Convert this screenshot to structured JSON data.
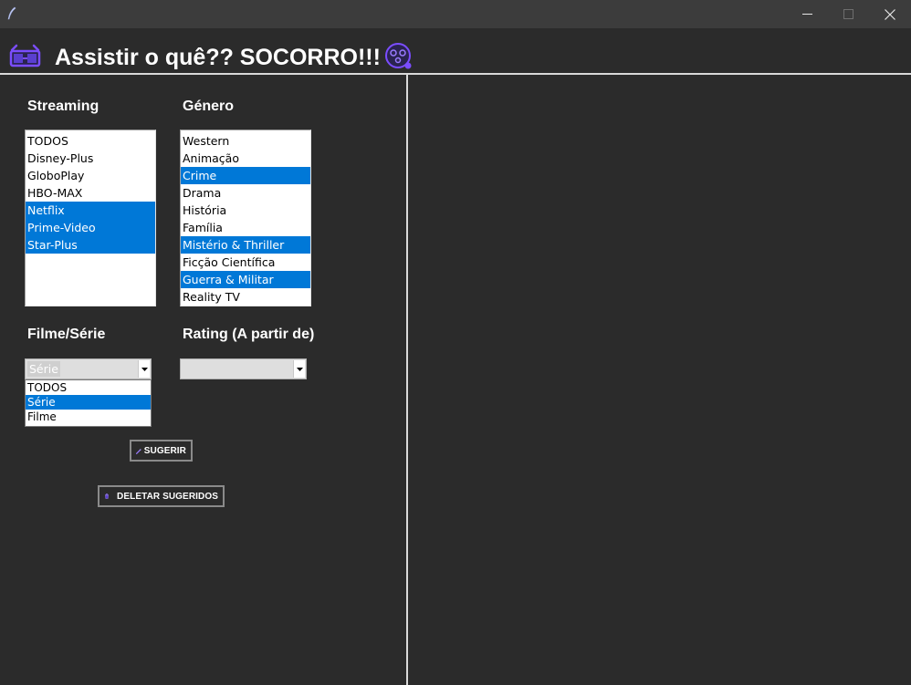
{
  "window": {
    "icons": {
      "app": "feather-icon",
      "minimize": "minimize-icon",
      "maximize": "maximize-icon",
      "close": "close-icon"
    }
  },
  "header": {
    "title": "Assistir o quê?? SOCORRO!!!",
    "left_icon": "3d-glasses-icon",
    "right_icon": "dizzy-face-icon",
    "accent": "#7b4dff"
  },
  "streaming": {
    "label": "Streaming",
    "items": [
      {
        "label": "TODOS",
        "selected": false
      },
      {
        "label": "Disney-Plus",
        "selected": false
      },
      {
        "label": "GloboPlay",
        "selected": false
      },
      {
        "label": "HBO-MAX",
        "selected": false
      },
      {
        "label": "Netflix",
        "selected": true
      },
      {
        "label": "Prime-Video",
        "selected": true
      },
      {
        "label": "Star-Plus",
        "selected": true
      }
    ]
  },
  "genero": {
    "label": "Género",
    "items": [
      {
        "label": "Western",
        "selected": false
      },
      {
        "label": "Animação",
        "selected": false
      },
      {
        "label": "Crime",
        "selected": true
      },
      {
        "label": "Drama",
        "selected": false
      },
      {
        "label": "História",
        "selected": false
      },
      {
        "label": "Família",
        "selected": false
      },
      {
        "label": "Mistério & Thriller",
        "selected": true
      },
      {
        "label": "Ficção Científica",
        "selected": false
      },
      {
        "label": "Guerra & Militar",
        "selected": true
      },
      {
        "label": "Reality TV",
        "selected": false
      }
    ]
  },
  "tipo": {
    "label": "Filme/Série",
    "value": "Série",
    "options": [
      {
        "label": "TODOS",
        "selected": false
      },
      {
        "label": "Série",
        "selected": true
      },
      {
        "label": "Filme",
        "selected": false
      }
    ]
  },
  "rating": {
    "label": "Rating (A partir de)",
    "value": ""
  },
  "buttons": {
    "sugerir": {
      "label": "SUGERIR",
      "icon": "magic-wand-icon"
    },
    "deletar": {
      "label": "DELETAR SUGERIDOS",
      "icon": "trash-icon"
    }
  },
  "colors": {
    "background": "#2b2b2b",
    "titlebar": "#3c3c3c",
    "selection": "#0078d7",
    "separator": "#d9d9d9"
  }
}
